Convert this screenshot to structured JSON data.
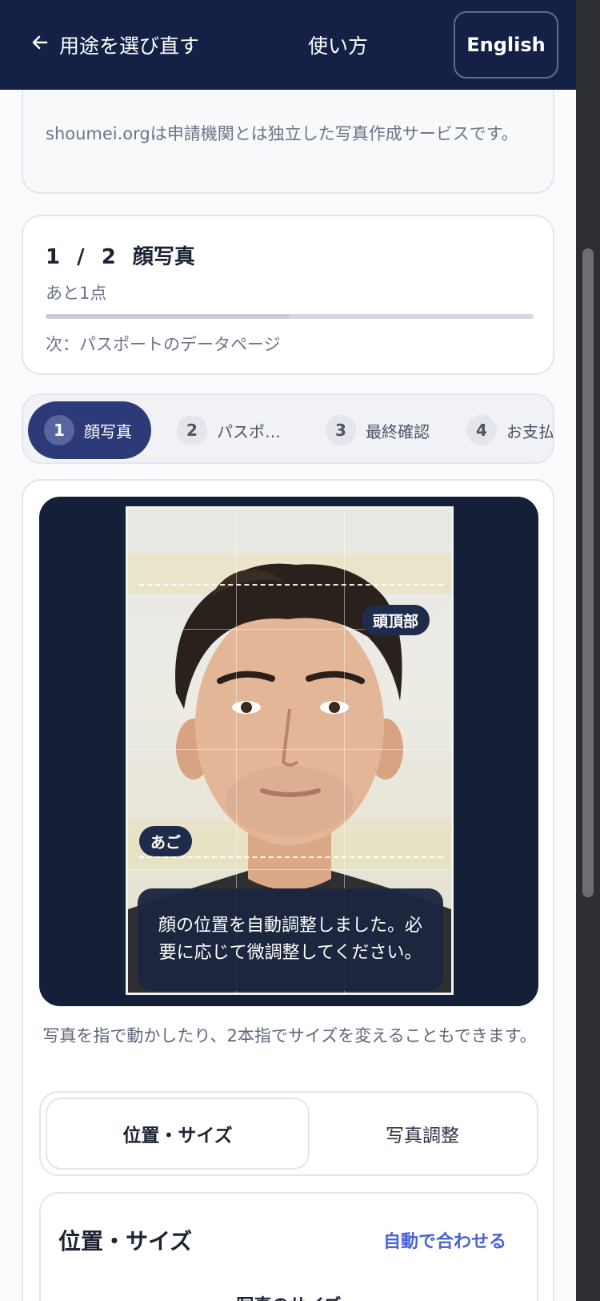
{
  "header": {
    "back_label": "用途を選び直す",
    "howto_label": "使い方",
    "language_label": "English"
  },
  "notice": {
    "text": "shoumei.orgは申請機関とは独立した写真作成サービスです。"
  },
  "progress": {
    "step": "1 / 2",
    "title": "顔写真",
    "remaining": "あと1点",
    "fraction": 0.5,
    "next": "次：パスポートのデータページ"
  },
  "stepper": {
    "steps": [
      {
        "num": "1",
        "label": "顔写真",
        "active": true
      },
      {
        "num": "2",
        "label": "パスポ…",
        "active": false
      },
      {
        "num": "3",
        "label": "最終確認",
        "active": false
      },
      {
        "num": "4",
        "label": "お支払",
        "active": false
      }
    ]
  },
  "editor": {
    "crown_tag": "頭頂部",
    "chin_tag": "あご",
    "toast": "顔の位置を自動調整しました。必要に応じて微調整してください。",
    "hint": "写真を指で動かしたり、2本指でサイズを変えることもできます。"
  },
  "tabs": {
    "position_size": "位置・サイズ",
    "photo_adjust": "写真調整"
  },
  "panel": {
    "title": "位置・サイズ",
    "auto_fit": "自動で合わせる",
    "photo_size_label": "写真のサイズ"
  },
  "colors": {
    "header_bg": "#152046",
    "accent_dark": "#2c3a78",
    "link_blue": "#4a63d6"
  }
}
